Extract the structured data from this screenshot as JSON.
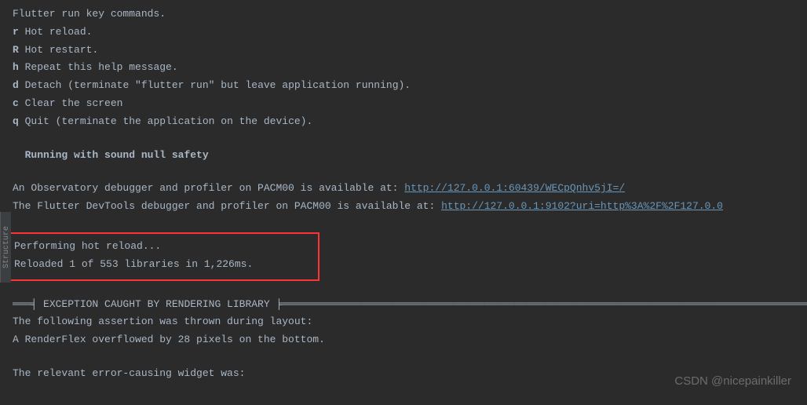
{
  "header": "Flutter run key commands.",
  "commands": [
    {
      "key": "r",
      "desc": "Hot reload."
    },
    {
      "key": "R",
      "desc": "Hot restart."
    },
    {
      "key": "h",
      "desc": "Repeat this help message."
    },
    {
      "key": "d",
      "desc": "Detach (terminate \"flutter run\" but leave application running)."
    },
    {
      "key": "c",
      "desc": "Clear the screen"
    },
    {
      "key": "q",
      "desc": "Quit (terminate the application on the device)."
    }
  ],
  "status": "Running with sound null safety",
  "observatory": {
    "prefix": "An Observatory debugger and profiler on PACM00 is available at: ",
    "link": "http://127.0.0.1:60439/WECpQnhv5jI=/"
  },
  "devtools": {
    "prefix": "The Flutter DevTools debugger and profiler on PACM00 is available at: ",
    "link": "http://127.0.0.1:9102?uri=http%3A%2F%2F127.0.0"
  },
  "reload": {
    "line1": "Performing hot reload...",
    "line2": "Reloaded 1 of 553 libraries in 1,226ms."
  },
  "exception": {
    "banner_prefix": "═══╡ ",
    "banner_title": "EXCEPTION CAUGHT BY RENDERING LIBRARY",
    "banner_suffix": " ╞═══════════════════════════════════════════════════════════════════════════════════════════",
    "line1": "The following assertion was thrown during layout:",
    "line2": "A RenderFlex overflowed by 28 pixels on the bottom.",
    "line3": "The relevant error-causing widget was:"
  },
  "watermark": "CSDN @nicepainkiller",
  "sidebar": "Structure"
}
